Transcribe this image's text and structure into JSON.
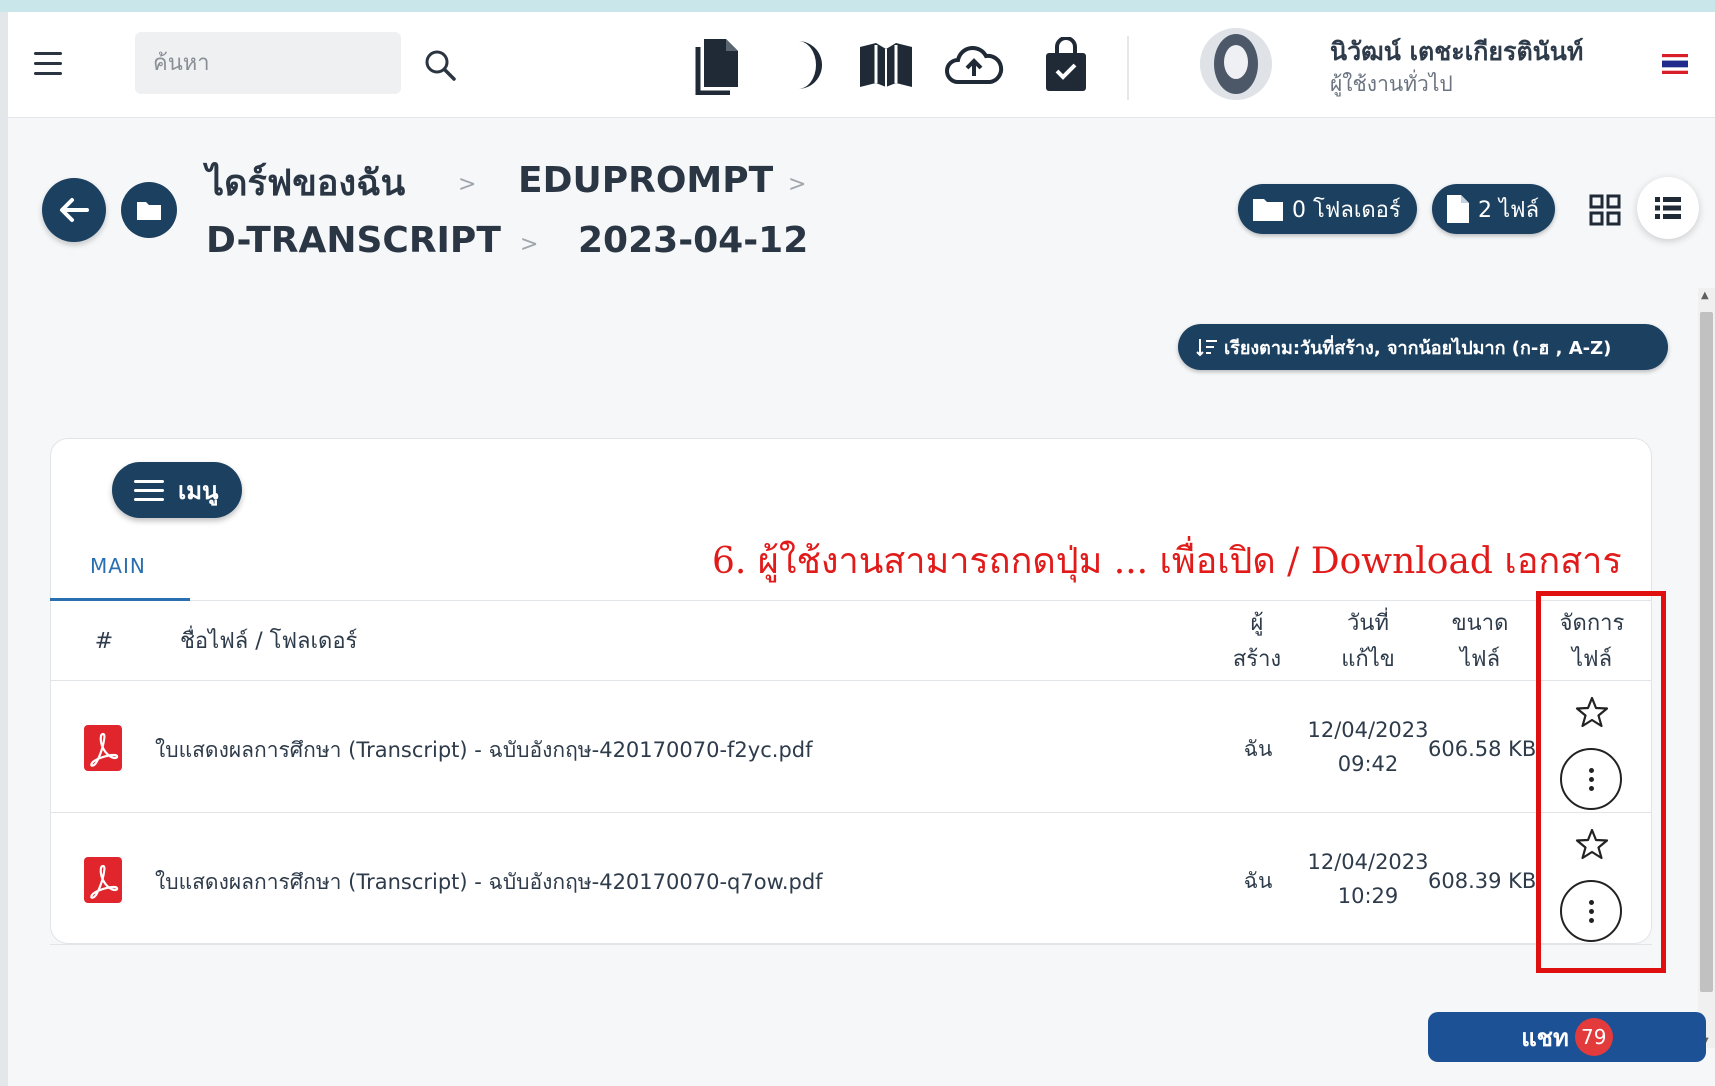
{
  "topbar": {
    "search_placeholder": "ค้นหา",
    "user_name": "นิวัฒน์ เตชะเกียรตินันท์",
    "user_role": "ผู้ใช้งานทั่วไป",
    "tools": [
      "document-icon",
      "moon-icon",
      "book-icon",
      "cloud-upload-icon",
      "shopping-bag-icon"
    ]
  },
  "breadcrumb": {
    "items": [
      "ไดร์ฟของฉัน",
      "EDUPROMPT",
      "D-TRANSCRIPT",
      "2023-04-12"
    ],
    "separator": ">"
  },
  "counts": {
    "folders_label": "0 โฟลเดอร์",
    "files_label": "2 ไฟล์"
  },
  "sort": {
    "label": "เรียงตาม:วันที่สร้าง, จากน้อยไปมาก (ก-ฮ , A-Z)"
  },
  "menu_label": "เมนู",
  "tabs": [
    "MAIN"
  ],
  "table": {
    "headers": {
      "index": "#",
      "name": "ชื่อไฟล์ / โฟลเดอร์",
      "creator_1": "ผู้",
      "creator_2": "สร้าง",
      "date_1": "วันที่",
      "date_2": "แก้ไข",
      "size_1": "ขนาด",
      "size_2": "ไฟล์",
      "manage_1": "จัดการ",
      "manage_2": "ไฟล์"
    },
    "rows": [
      {
        "name": "ใบแสดงผลการศึกษา (Transcript) - ฉบับอังกฤษ-420170070-f2yc.pdf",
        "creator": "ฉัน",
        "date": "12/04/2023",
        "time": "09:42",
        "size": "606.58 KB"
      },
      {
        "name": "ใบแสดงผลการศึกษา (Transcript) - ฉบับอังกฤษ-420170070-q7ow.pdf",
        "creator": "ฉัน",
        "date": "12/04/2023",
        "time": "10:29",
        "size": "608.39 KB"
      }
    ]
  },
  "annotation": "6. ผู้ใช้งานสามารถกดปุ่ม ... เพื่อเปิด / Download เอกสาร",
  "chat": {
    "label": "แชท",
    "badge": "79"
  },
  "colors": {
    "primary": "#1c4060",
    "accent_blue": "#2a6fb2",
    "annotation_red": "#e11a1a",
    "chat_blue": "#1c5196",
    "badge_red": "#e33b3b",
    "pdf_red": "#e0262c"
  }
}
